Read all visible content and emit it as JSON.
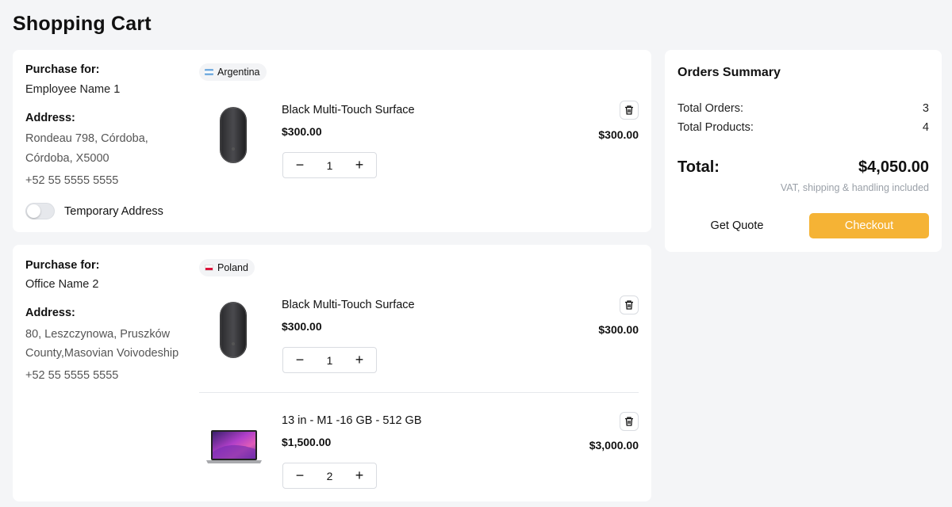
{
  "page": {
    "title": "Shopping Cart"
  },
  "orders": [
    {
      "purchase_for_label": "Purchase for:",
      "purchase_for": "Employee Name 1",
      "address_label": "Address:",
      "address_line1": "Rondeau 798, Córdoba,",
      "address_line2": "Córdoba, X5000",
      "phone": "+52 55 5555 5555",
      "toggle_label": "Temporary Address",
      "country": "Argentina",
      "items": [
        {
          "name": "Black Multi-Touch Surface",
          "price": "$300.00",
          "quantity": "1",
          "total": "$300.00",
          "image": "mouse"
        }
      ]
    },
    {
      "purchase_for_label": "Purchase for:",
      "purchase_for": "Office Name 2",
      "address_label": "Address:",
      "address_line1": "80, Leszczynowa, Pruszków",
      "address_line2": "County,Masovian Voivodeship",
      "phone": "+52 55 5555 5555",
      "country": "Poland",
      "items": [
        {
          "name": "Black Multi-Touch Surface",
          "price": "$300.00",
          "quantity": "1",
          "total": "$300.00",
          "image": "mouse"
        },
        {
          "name": "13 in - M1 -16 GB - 512 GB",
          "price": "$1,500.00",
          "quantity": "2",
          "total": "$3,000.00",
          "image": "laptop"
        }
      ]
    }
  ],
  "summary": {
    "title": "Orders Summary",
    "total_orders_label": "Total Orders:",
    "total_orders": "3",
    "total_products_label": "Total Products:",
    "total_products": "4",
    "total_label": "Total:",
    "total": "$4,050.00",
    "note": "VAT, shipping & handling included",
    "get_quote": "Get Quote",
    "checkout": "Checkout"
  },
  "controls": {
    "minus": "−",
    "plus": "+"
  },
  "icons": [
    "trash-icon",
    "flag-argentina-icon",
    "flag-poland-icon",
    "mouse-image",
    "laptop-image"
  ],
  "colors": {
    "accent": "#f5b335",
    "background": "#f4f5f7",
    "card": "#ffffff"
  }
}
